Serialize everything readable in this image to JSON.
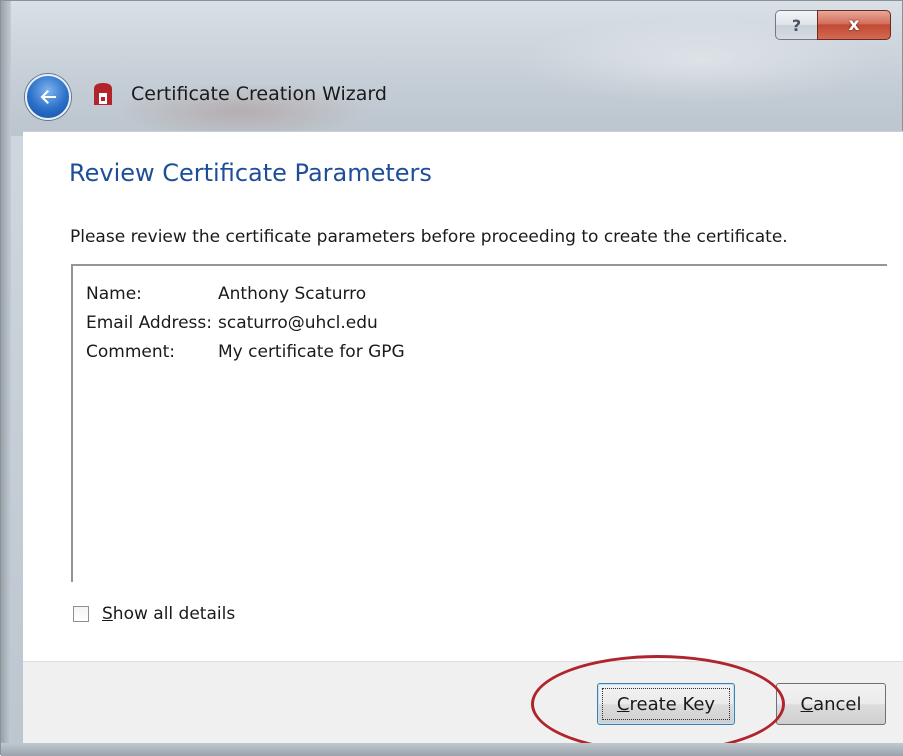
{
  "window": {
    "title": "Certificate Creation Wizard",
    "help_label": "?",
    "close_label": "x"
  },
  "page": {
    "heading": "Review Certificate Parameters",
    "instructions": "Please review the certificate parameters before proceeding to create the certificate."
  },
  "details": [
    {
      "key": "Name:",
      "value": "Anthony Scaturro"
    },
    {
      "key": "Email Address:",
      "value": "scaturro@uhcl.edu"
    },
    {
      "key": "Comment:",
      "value": "My certificate for GPG"
    }
  ],
  "options": {
    "show_all_details": {
      "label_access": "S",
      "label_rest": "how all details",
      "checked": false
    }
  },
  "buttons": {
    "create_key": {
      "access": "C",
      "rest": "reate Key"
    },
    "cancel": {
      "access": "C",
      "rest": "ancel"
    }
  },
  "colors": {
    "heading": "#1f4e99",
    "annotation": "#b0242c",
    "close_button": "#c24a34"
  },
  "icons": {
    "back": "back-arrow-icon",
    "app": "kleopatra-certificate-icon",
    "help": "help-icon",
    "close": "close-icon"
  }
}
